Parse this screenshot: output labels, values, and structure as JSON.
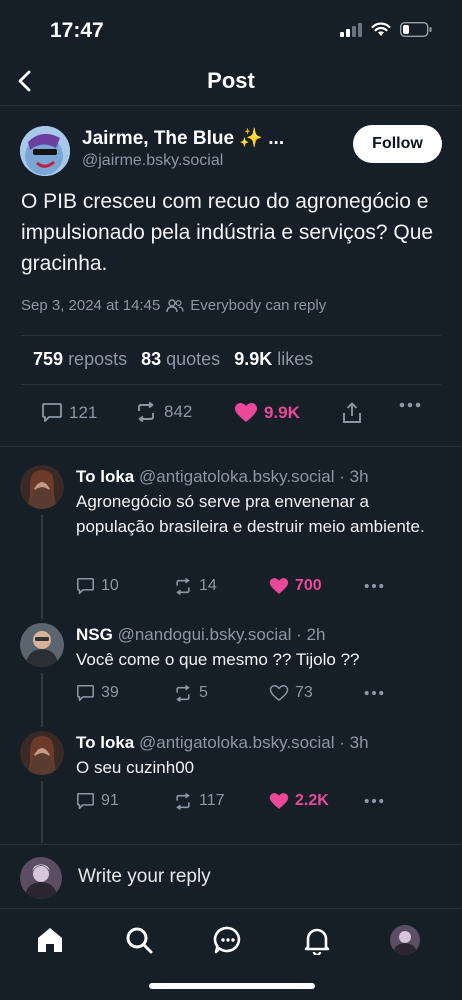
{
  "status_bar": {
    "time": "17:47"
  },
  "header": {
    "title": "Post"
  },
  "post": {
    "author_name": "Jairme, The Blue ✨ ...",
    "author_handle": "@jairme.bsky.social",
    "follow_label": "Follow",
    "text": "O PIB cresceu com recuo do agronegócio e impulsionado pela indústria e serviços? Que gracinha.",
    "timestamp": "Sep 3, 2024 at 14:45",
    "reply_setting": "Everybody can reply",
    "stats": {
      "reposts_count": "759",
      "reposts_label": "reposts",
      "quotes_count": "83",
      "quotes_label": "quotes",
      "likes_count": "9.9K",
      "likes_label": "likes"
    },
    "actions": {
      "replies": "121",
      "reposts": "842",
      "likes": "9.9K"
    }
  },
  "replies": [
    {
      "name": "To loka",
      "handle": "@antigatoloka.bsky.social",
      "time": "· 3h",
      "text": "Agronegócio só serve pra envenenar a população brasileira e destruir meio ambiente.",
      "replies": "10",
      "reposts": "14",
      "likes": "700",
      "liked": true
    },
    {
      "name": "NSG",
      "handle": "@nandogui.bsky.social",
      "time": "· 2h",
      "text": "Você come o que mesmo ?? Tijolo ??",
      "replies": "39",
      "reposts": "5",
      "likes": "73",
      "liked": false
    },
    {
      "name": "To loka",
      "handle": "@antigatoloka.bsky.social",
      "time": "· 3h",
      "text": "O seu cuzinh00",
      "replies": "91",
      "reposts": "117",
      "likes": "2.2K",
      "liked": true
    }
  ],
  "composer": {
    "placeholder": "Write your reply"
  },
  "tabbar": {
    "tabs": [
      "home-icon",
      "search-icon",
      "chat-icon",
      "bell-icon",
      "profile-avatar"
    ]
  },
  "colors": {
    "background": "#161e27",
    "like": "#ec4899",
    "muted": "#8b98a5"
  }
}
